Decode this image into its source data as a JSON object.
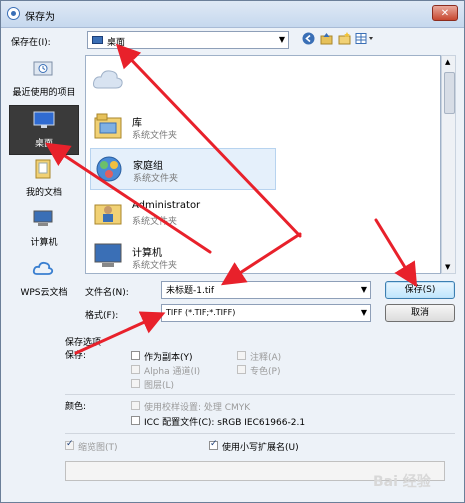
{
  "window": {
    "title": "保存为",
    "close": "✕"
  },
  "toolbar": {
    "save_in_label": "保存在(I):",
    "save_in_value": "桌面",
    "buttons": [
      "back-icon",
      "up-folder-icon",
      "new-folder-icon",
      "view-menu-icon"
    ]
  },
  "places": [
    {
      "label": "最近使用的项目",
      "icon": "recent-icon"
    },
    {
      "label": "桌面",
      "icon": "desktop-icon",
      "selected": true
    },
    {
      "label": "我的文档",
      "icon": "documents-icon"
    },
    {
      "label": "计算机",
      "icon": "computer-icon"
    },
    {
      "label": "WPS云文档",
      "icon": "cloud-icon"
    }
  ],
  "files": [
    {
      "name": "",
      "sub": "",
      "icon": "cloud-drive-icon"
    },
    {
      "name": "库",
      "sub": "系统文件夹",
      "icon": "library-icon"
    },
    {
      "name": "家庭组",
      "sub": "系统文件夹",
      "icon": "homegroup-icon"
    },
    {
      "name": "Administrator",
      "sub": "系统文件夹",
      "icon": "user-folder-icon"
    },
    {
      "name": "计算机",
      "sub": "系统文件夹",
      "icon": "computer-icon"
    }
  ],
  "filename": {
    "label": "文件名(N):",
    "value": "未标题-1.tif"
  },
  "format": {
    "label": "格式(F):",
    "value": "TIFF (*.TIF;*.TIFF)"
  },
  "buttons": {
    "save": "保存(S)",
    "cancel": "取消"
  },
  "options": {
    "heading": "保存选项",
    "save_label": "保存:",
    "as_copy": "作为副本(Y)",
    "notes": "注释(A)",
    "alpha": "Alpha 通道(I)",
    "spot": "专色(P)",
    "layers": "图层(L)",
    "color_label": "颜色:",
    "proof": "使用校样设置: 处理 CMYK",
    "icc": "ICC 配置文件(C): sRGB IEC61966-2.1",
    "thumbnail": "缩览图(T)",
    "lowercase": "使用小写扩展名(U)"
  },
  "watermark": "Bai 经验"
}
